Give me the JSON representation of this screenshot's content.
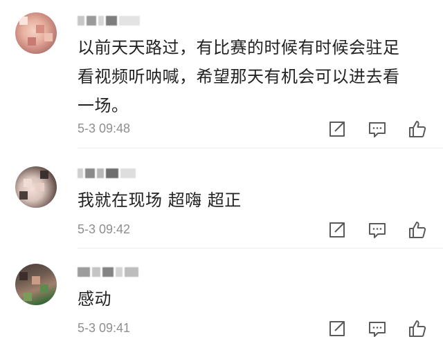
{
  "comments": [
    {
      "text_line1": "以前天天路过，有比赛的时候有时候会驻足",
      "text_line2": "看视频听呐喊，希望那天有机会可以进去看",
      "text_line3": "一场。",
      "time": "5-3 09:48",
      "actions": [
        "share-icon",
        "reply-icon",
        "like-icon"
      ]
    },
    {
      "text_line1": "我就在现场 超嗨 超正",
      "time": "5-3 09:42",
      "actions": [
        "share-icon",
        "reply-icon",
        "like-icon"
      ]
    },
    {
      "text_line1": "感动",
      "time": "5-3 09:41",
      "actions": [
        "share-icon",
        "reply-icon",
        "like-icon"
      ]
    }
  ],
  "colors": {
    "text": "#222222",
    "timestamp": "#8e8e8e",
    "icon": "#5a5a5a",
    "divider": "#ececec"
  }
}
